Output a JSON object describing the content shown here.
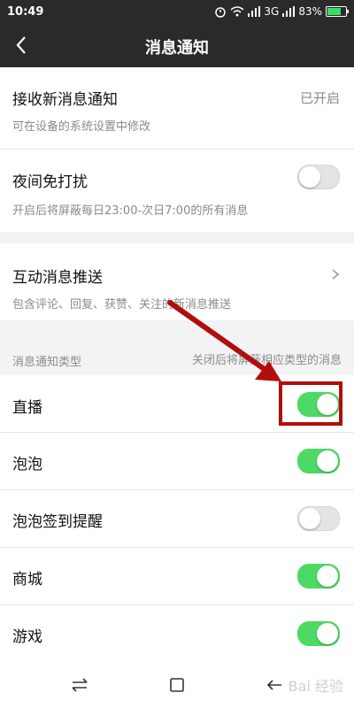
{
  "status": {
    "time": "10:49",
    "network": "3G",
    "battery": "83%"
  },
  "nav": {
    "title": "消息通知"
  },
  "receive": {
    "title": "接收新消息通知",
    "value": "已开启",
    "subtitle": "可在设备的系统设置中修改"
  },
  "dnd": {
    "title": "夜间免打扰",
    "subtitle": "开启后将屏蔽每日23:00-次日7:00的所有消息",
    "toggle": "off"
  },
  "push": {
    "title": "互动消息推送",
    "subtitle": "包含评论、回复、获赞、关注的新消息推送"
  },
  "section": {
    "label": "消息通知类型",
    "note": "关闭后将屏蔽相应类型的消息"
  },
  "types": [
    {
      "label": "直播",
      "state": "on"
    },
    {
      "label": "泡泡",
      "state": "on"
    },
    {
      "label": "泡泡签到提醒",
      "state": "off"
    },
    {
      "label": "商城",
      "state": "on"
    },
    {
      "label": "游戏",
      "state": "on"
    }
  ],
  "watermark": {
    "text": "Bai 经验"
  },
  "colors": {
    "accent": "#4cd964",
    "annotation": "#b10d0d",
    "header": "#2a2a2a"
  }
}
